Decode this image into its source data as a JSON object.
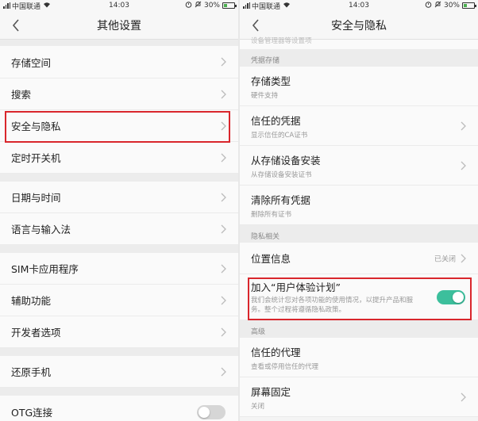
{
  "status_bar": {
    "carrier": "中国联通",
    "time": "14:03",
    "battery": "30%",
    "battery_level": 0.3
  },
  "colors": {
    "toggle_on": "#3cbf9c",
    "highlight": "#d9262c",
    "battery_fill": "#4caf50"
  },
  "left_screen": {
    "title": "其他设置",
    "items": [
      {
        "label": "存储空间"
      },
      {
        "label": "搜索"
      },
      {
        "label": "安全与隐私"
      },
      {
        "label": "定时开关机"
      },
      {
        "label": "日期与时间"
      },
      {
        "label": "语言与输入法"
      },
      {
        "label": "SIM卡应用程序"
      },
      {
        "label": "辅助功能"
      },
      {
        "label": "开发者选项"
      },
      {
        "label": "还原手机"
      },
      {
        "label": "OTG连接",
        "toggle": "off"
      }
    ]
  },
  "right_screen": {
    "title": "安全与隐私",
    "top_partial": "设备管理器等设置项",
    "sections": [
      {
        "header": "凭据存储",
        "items": [
          {
            "label": "存储类型",
            "sub": "硬件支持"
          },
          {
            "label": "信任的凭据",
            "sub": "显示信任的CA证书"
          },
          {
            "label": "从存储设备安装",
            "sub": "从存储设备安装证书"
          },
          {
            "label": "清除所有凭据",
            "sub": "删除所有证书"
          }
        ]
      },
      {
        "header": "隐私相关",
        "items": [
          {
            "label": "位置信息",
            "value": "已关闭"
          },
          {
            "label": "加入“用户体验计划”",
            "sub": "我们会统计您对各项功能的使用情况，以提升产品和服务。整个过程将遵循隐私政策。",
            "toggle": "on"
          }
        ]
      },
      {
        "header": "高级",
        "items": [
          {
            "label": "信任的代理",
            "sub": "查看或停用信任的代理"
          },
          {
            "label": "屏幕固定",
            "sub": "关闭"
          }
        ]
      }
    ]
  }
}
